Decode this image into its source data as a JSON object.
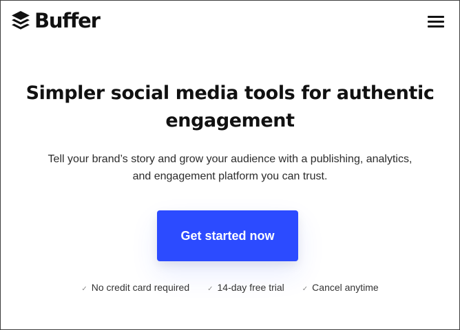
{
  "header": {
    "logo_text": "Buffer",
    "logo_icon": "stacked-layers-icon",
    "menu_icon": "hamburger-menu-icon"
  },
  "hero": {
    "title": "Simpler social media tools for authentic engagement",
    "subtitle": "Tell your brand’s story and grow your audience with a publishing, analytics, and engagement platform you can trust.",
    "cta_label": "Get started now"
  },
  "perks": [
    {
      "icon": "check-icon",
      "label": "No credit card required"
    },
    {
      "icon": "check-icon",
      "label": "14-day free trial"
    },
    {
      "icon": "check-icon",
      "label": "Cancel anytime"
    }
  ],
  "colors": {
    "accent": "#2c4bff",
    "text": "#111111",
    "border": "#3d3d3d"
  }
}
